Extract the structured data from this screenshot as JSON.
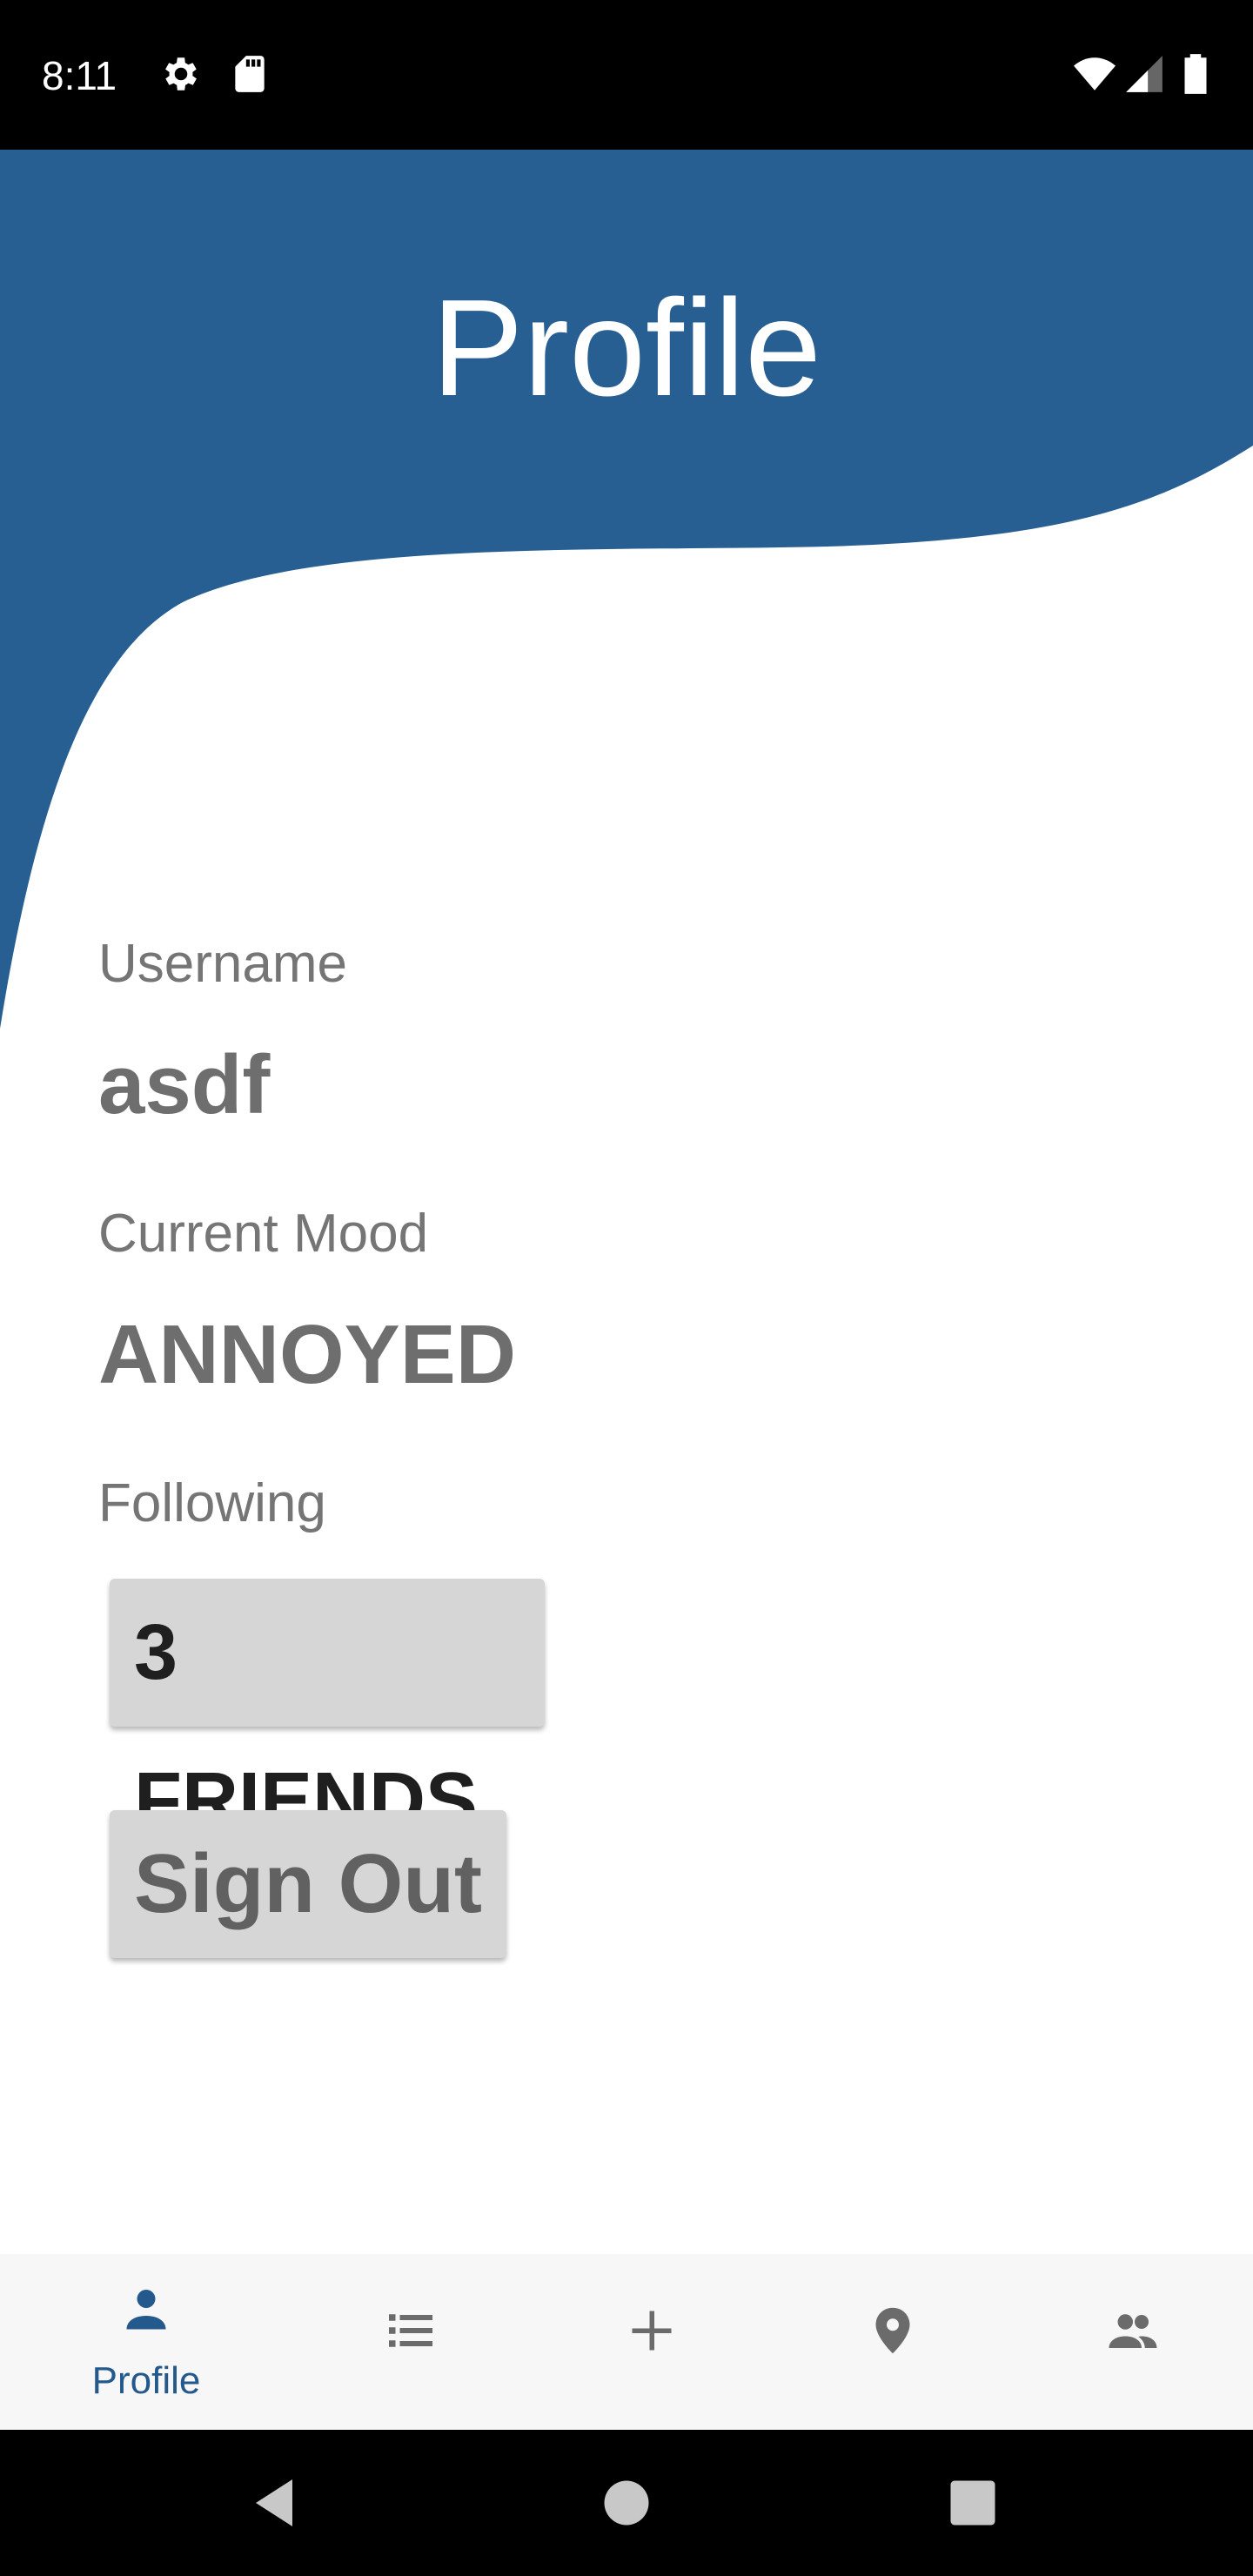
{
  "status_bar": {
    "time": "8:11",
    "icons": [
      "settings-icon",
      "sd-card-icon",
      "wifi-icon",
      "signal-icon",
      "battery-icon"
    ]
  },
  "header": {
    "title": "Profile",
    "color": "#275f93"
  },
  "profile": {
    "username_label": "Username",
    "username_value": "asdf",
    "mood_label": "Current Mood",
    "mood_value": "ANNOYED",
    "following_label": "Following"
  },
  "buttons": {
    "friends_label": "3 FRIENDS",
    "signout_label": "Sign Out"
  },
  "bottom_nav": {
    "active_color": "#23598c",
    "inactive_color": "#6b6b6b",
    "items": [
      {
        "icon": "person-icon",
        "label": "Profile",
        "active": true
      },
      {
        "icon": "list-icon",
        "label": "",
        "active": false
      },
      {
        "icon": "plus-icon",
        "label": "",
        "active": false
      },
      {
        "icon": "location-pin-icon",
        "label": "",
        "active": false
      },
      {
        "icon": "people-icon",
        "label": "",
        "active": false
      }
    ]
  },
  "system_nav": {
    "icons": [
      "back-icon",
      "home-icon",
      "recents-icon"
    ]
  }
}
